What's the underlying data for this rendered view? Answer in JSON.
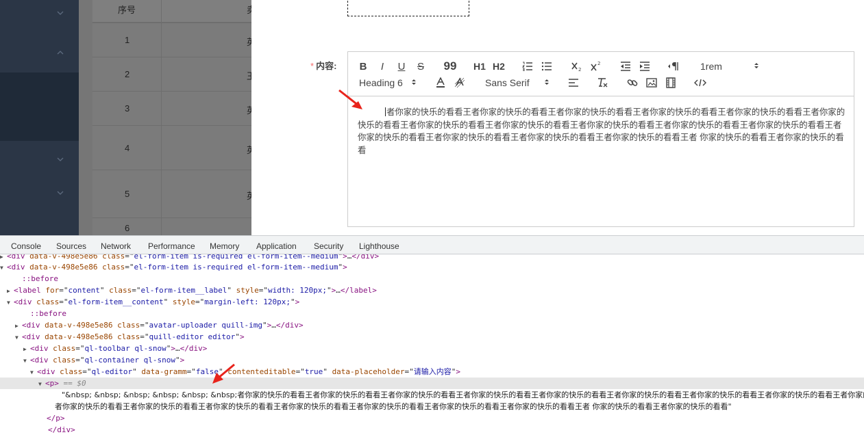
{
  "table": {
    "header_index": "序号",
    "header_col2_partial": "卖",
    "rows": [
      {
        "index": "1",
        "col2": "英"
      },
      {
        "index": "2",
        "col2": "王"
      },
      {
        "index": "3",
        "col2": "英"
      },
      {
        "index": "4",
        "col2": "英"
      },
      {
        "index": "5",
        "col2": "英"
      },
      {
        "index": "6",
        "col2": ""
      }
    ]
  },
  "form": {
    "content_label": "内容:",
    "required_mark": "*",
    "toolbar": {
      "bold": "B",
      "italic": "I",
      "underline": "U",
      "strike": "S",
      "blockquote": "99",
      "h1": "H1",
      "h2": "H2",
      "size_value": "1rem",
      "header_value": "Heading 6",
      "font_value": "Sans Serif"
    },
    "editor_text": "者你家的快乐的看看王者你家的快乐的看看王者你家的快乐的看看王者你家的快乐的看看王者你家的快乐的看看王者你家的快乐的看看王者你家的快乐的看看王者你家的快乐的看看王者你家的快乐的看看王者你家的快乐的看看王者你家的快乐的看看王者你家的快乐的看看王者你家的快乐的看看王者你家的快乐的看看王者你家的快乐的看看王者 你家的快乐的看看王者你家的快乐的看看"
  },
  "devtools": {
    "tabs": [
      "Console",
      "Sources",
      "Network",
      "Performance",
      "Memory",
      "Application",
      "Security",
      "Lighthouse"
    ],
    "dom_lines": [
      {
        "t": "▶",
        "html": "<span class='tag'>&lt;div</span> <span class='attr'>data-v-498e5e86</span> <span class='attr'>class</span>=\"<span class='val'>el-form-item is-required el-form-item--medium</span>\"<span class='tag'>&gt;</span>…<span class='tag'>&lt;/div&gt;</span>"
      },
      {
        "t": "▼",
        "html": "<span class='tag'>&lt;div</span> <span class='attr'>data-v-498e5e86</span> <span class='attr'>class</span>=\"<span class='val'>el-form-item is-required el-form-item--medium</span>\"<span class='tag'>&gt;</span>"
      },
      {
        "t": "",
        "html": "<span class='pseudo'>::before</span>"
      },
      {
        "t": "▶",
        "html": "<span class='tag'>&lt;label</span> <span class='attr'>for</span>=\"<span class='val'>content</span>\" <span class='attr'>class</span>=\"<span class='val'>el-form-item__label</span>\" <span class='attr'>style</span>=\"<span class='val'>width: 120px;</span>\"<span class='tag'>&gt;</span>…<span class='tag'>&lt;/label&gt;</span>"
      },
      {
        "t": "▼",
        "html": "<span class='tag'>&lt;div</span> <span class='attr'>class</span>=\"<span class='val'>el-form-item__content</span>\" <span class='attr'>style</span>=\"<span class='val'>margin-left: 120px;</span>\"<span class='tag'>&gt;</span>"
      },
      {
        "t": "",
        "html": "<span class='pseudo'>::before</span>"
      },
      {
        "t": "▶",
        "html": "<span class='tag'>&lt;div</span> <span class='attr'>data-v-498e5e86</span> <span class='attr'>class</span>=\"<span class='val'>avatar-uploader quill-img</span>\"<span class='tag'>&gt;</span>…<span class='tag'>&lt;/div&gt;</span>"
      },
      {
        "t": "▼",
        "html": "<span class='tag'>&lt;div</span> <span class='attr'>data-v-498e5e86</span> <span class='attr'>class</span>=\"<span class='val'>quill-editor editor</span>\"<span class='tag'>&gt;</span>"
      },
      {
        "t": "▶",
        "html": "<span class='tag'>&lt;div</span> <span class='attr'>class</span>=\"<span class='val'>ql-toolbar ql-snow</span>\"<span class='tag'>&gt;</span>…<span class='tag'>&lt;/div&gt;</span>"
      },
      {
        "t": "▼",
        "html": "<span class='tag'>&lt;div</span> <span class='attr'>class</span>=\"<span class='val'>ql-container ql-snow</span>\"<span class='tag'>&gt;</span>"
      },
      {
        "t": "▼",
        "html": "<span class='tag'>&lt;div</span> <span class='attr'>class</span>=\"<span class='val'>ql-editor</span>\" <span class='attr'>data-gramm</span>=\"<span class='val'>false</span>\" <span class='attr'>contenteditable</span>=\"<span class='val'>true</span>\" <span class='attr'>data-placeholder</span>=\"<span class='val'>请输入内容</span>\"<span class='tag'>&gt;</span>"
      },
      {
        "t": "▼",
        "html": "<span class='tag'>&lt;p&gt;</span> <span class='eq'>== $0</span>"
      },
      {
        "t": "",
        "html": "<span class='txt'>\"&amp;nbsp; &amp;nbsp; &amp;nbsp; &amp;nbsp; &amp;nbsp; &amp;nbsp;者你家的快乐的看看王者你家的快乐的看看王者你家的快乐的看看王者你家的快乐的看看王者你家的快乐的看看王者你家的快乐的看看王者你家的快乐的看看王者你家的快乐的看看王者你家的快乐的看看王者你家的快</span>"
      },
      {
        "t": "",
        "html": "<span class='txt'>者你家的快乐的看看王者你家的快乐的看看王者你家的快乐的看看王者你家的快乐的看看王者你家的快乐的看看王者你家的快乐的看看王者你家的快乐的看看王者  你家的快乐的看看王者你家的快乐的看看\"</span>"
      },
      {
        "t": "",
        "html": "<span class='tag'>&lt;/p&gt;</span>"
      },
      {
        "t": "",
        "html": "<span class='tag'>&lt;/div&gt;</span>"
      }
    ]
  },
  "colors": {
    "sidebar": "#2b3646",
    "required": "#f56c6c",
    "arrow": "#e8231b"
  }
}
